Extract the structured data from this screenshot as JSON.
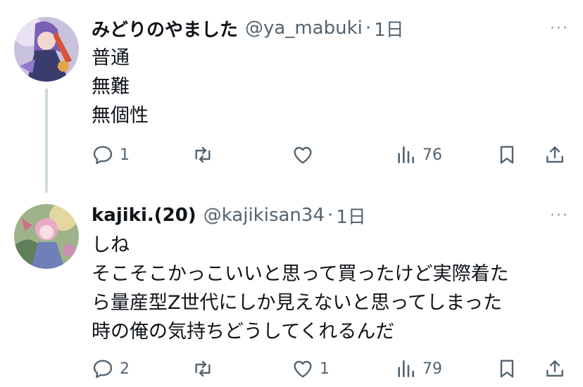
{
  "tweets": [
    {
      "name": "みどりのやました",
      "handle": "@ya_mabuki",
      "time": "1日",
      "body": [
        "普通",
        "無難",
        "無個性"
      ],
      "replies": "1",
      "retweets": "",
      "likes": "",
      "views": "76"
    },
    {
      "name": "kajiki.(20)",
      "handle": "@kajikisan34",
      "time": "1日",
      "body": [
        "しね",
        "そこそこかっこいいと思って買ったけど実際着た",
        "ら量産型Z世代にしか見えないと思ってしまった",
        "時の俺の気持ちどうしてくれるんだ"
      ],
      "replies": "2",
      "retweets": "",
      "likes": "1",
      "views": "79"
    }
  ],
  "separator": "·",
  "more_glyph": "···",
  "icons": [
    "reply-icon",
    "retweet-icon",
    "like-icon",
    "views-icon",
    "bookmark-icon",
    "share-icon",
    "more-icon"
  ],
  "colors": {
    "text": "#0f1419",
    "secondary": "#536471",
    "thread_line": "#cfd9de"
  }
}
